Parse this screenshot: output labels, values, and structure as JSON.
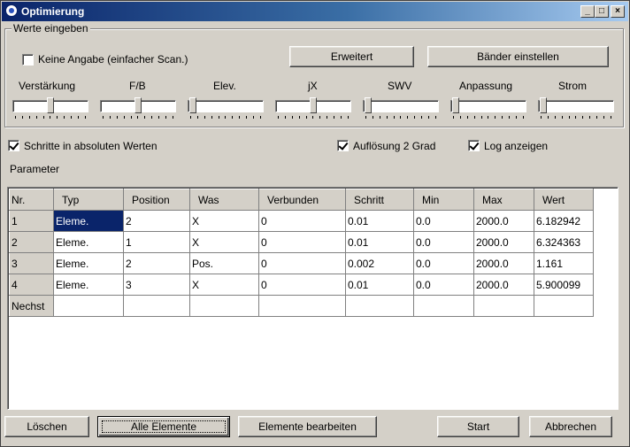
{
  "window": {
    "title": "Optimierung",
    "controls": {
      "minimize": "_",
      "maximize": "□",
      "close": "×"
    }
  },
  "group": {
    "legend": "Werte eingeben",
    "no_spec_label": "Keine Angabe (einfacher Scan.)",
    "no_spec_checked": false,
    "advanced_button": "Erweitert",
    "bands_button": "Bänder  einstellen"
  },
  "sliders": [
    {
      "label": "Verstärkung",
      "level": 0.5
    },
    {
      "label": "F/B",
      "level": 0.5
    },
    {
      "label": "Elev.",
      "level": 0.0
    },
    {
      "label": "jX",
      "level": 0.5
    },
    {
      "label": "SWV",
      "level": 0.0
    },
    {
      "label": "Anpassung",
      "level": 0.0
    },
    {
      "label": "Strom",
      "level": 0.0
    }
  ],
  "options": {
    "absolute_steps": {
      "label": "Schritte in absoluten Werten",
      "checked": true
    },
    "resolution": {
      "label": "Auflösung 2 Grad",
      "checked": true
    },
    "show_log": {
      "label": "Log anzeigen",
      "checked": true
    }
  },
  "parameters_label": "Parameter",
  "table": {
    "columns": [
      "Nr.",
      "Typ",
      "Position",
      "Was",
      "Verbunden",
      "Schritt",
      "Min",
      "Max",
      "Wert"
    ],
    "rows": [
      [
        "1",
        "Eleme.",
        "2",
        "X",
        "0",
        "0.01",
        "0.0",
        "2000.0",
        "6.182942"
      ],
      [
        "2",
        "Eleme.",
        "1",
        "X",
        "0",
        "0.01",
        "0.0",
        "2000.0",
        "6.324363"
      ],
      [
        "3",
        "Eleme.",
        "2",
        "Pos.",
        "0",
        "0.002",
        "0.0",
        "2000.0",
        "1.161"
      ],
      [
        "4",
        "Eleme.",
        "3",
        "X",
        "0",
        "0.01",
        "0.0",
        "2000.0",
        "5.900099"
      ],
      [
        "Nechst",
        "",
        "",
        "",
        "",
        "",
        "",
        "",
        ""
      ]
    ]
  },
  "buttons": {
    "delete": "Löschen",
    "all_elements": "Alle Elemente",
    "edit_elements": "Elemente bearbeiten",
    "start": "Start",
    "cancel": "Abbrechen"
  }
}
